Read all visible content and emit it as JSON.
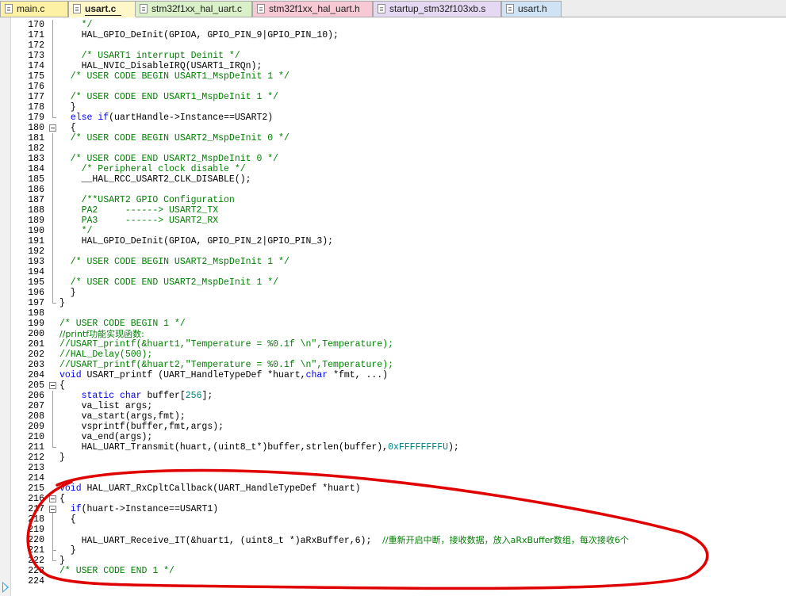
{
  "tabs": [
    {
      "label": "main.c",
      "color": "#fdf1a6",
      "active": false
    },
    {
      "label": "usart.c",
      "color": "#fff7c8",
      "active": true
    },
    {
      "label": "stm32f1xx_hal_uart.c",
      "color": "#d9f0c9",
      "active": false
    },
    {
      "label": "stm32f1xx_hal_uart.h",
      "color": "#f7c9d5",
      "active": false
    },
    {
      "label": "startup_stm32f103xb.s",
      "color": "#e5d8f2",
      "active": false
    },
    {
      "label": "usart.h",
      "color": "#cfe3f5",
      "active": false
    }
  ],
  "editor": {
    "first_line": 170,
    "lines": [
      [
        [
          "    */",
          "c"
        ]
      ],
      [
        [
          "    HAL_GPIO_DeInit(GPIOA, GPIO_PIN_9|GPIO_PIN_10);",
          ""
        ]
      ],
      [
        [
          "",
          ""
        ]
      ],
      [
        [
          "    /* USART1 interrupt Deinit */",
          "c"
        ]
      ],
      [
        [
          "    HAL_NVIC_DisableIRQ(USART1_IRQn);",
          ""
        ]
      ],
      [
        [
          "  /* USER CODE BEGIN USART1_MspDeInit 1 */",
          "c"
        ]
      ],
      [
        [
          "",
          ""
        ]
      ],
      [
        [
          "  /* USER CODE END USART1_MspDeInit 1 */",
          "c"
        ]
      ],
      [
        [
          "  }",
          ""
        ]
      ],
      [
        [
          "  ",
          ""
        ],
        [
          "else",
          "k"
        ],
        [
          " ",
          ""
        ],
        [
          "if",
          "k"
        ],
        [
          "(uartHandle->Instance==USART2)",
          ""
        ]
      ],
      [
        [
          "  {",
          ""
        ]
      ],
      [
        [
          "  /* USER CODE BEGIN USART2_MspDeInit 0 */",
          "c"
        ]
      ],
      [
        [
          "",
          ""
        ]
      ],
      [
        [
          "  /* USER CODE END USART2_MspDeInit 0 */",
          "c"
        ]
      ],
      [
        [
          "    /* Peripheral clock disable */",
          "c"
        ]
      ],
      [
        [
          "    __HAL_RCC_USART2_CLK_DISABLE();",
          ""
        ]
      ],
      [
        [
          "",
          ""
        ]
      ],
      [
        [
          "    /**USART2 GPIO Configuration",
          "c"
        ]
      ],
      [
        [
          "    PA2     ------> USART2_TX",
          "c"
        ]
      ],
      [
        [
          "    PA3     ------> USART2_RX",
          "c"
        ]
      ],
      [
        [
          "    */",
          "c"
        ]
      ],
      [
        [
          "    HAL_GPIO_DeInit(GPIOA, GPIO_PIN_2|GPIO_PIN_3);",
          ""
        ]
      ],
      [
        [
          "",
          ""
        ]
      ],
      [
        [
          "  /* USER CODE BEGIN USART2_MspDeInit 1 */",
          "c"
        ]
      ],
      [
        [
          "",
          ""
        ]
      ],
      [
        [
          "  /* USER CODE END USART2_MspDeInit 1 */",
          "c"
        ]
      ],
      [
        [
          "  }",
          ""
        ]
      ],
      [
        [
          "}",
          ""
        ]
      ],
      [
        [
          "",
          ""
        ]
      ],
      [
        [
          "/* USER CODE BEGIN 1 */",
          "c"
        ]
      ],
      [
        [
          "//printf功能实现函数:",
          "c"
        ]
      ],
      [
        [
          "//USART_printf(&huart1,\"Temperature = %0.1f \\n\",Temperature);",
          "c"
        ]
      ],
      [
        [
          "//HAL_Delay(500);",
          "c"
        ]
      ],
      [
        [
          "//USART_printf(&huart2,\"Temperature = %0.1f \\n\",Temperature);",
          "c"
        ]
      ],
      [
        [
          "void",
          "k"
        ],
        [
          " USART_printf (UART_HandleTypeDef *huart,",
          ""
        ],
        [
          "char",
          "k"
        ],
        [
          " *fmt, ...)",
          ""
        ]
      ],
      [
        [
          "{",
          ""
        ]
      ],
      [
        [
          "    ",
          ""
        ],
        [
          "static",
          "k"
        ],
        [
          " ",
          ""
        ],
        [
          "char",
          "k"
        ],
        [
          " buffer[",
          ""
        ],
        [
          "256",
          "n"
        ],
        [
          "];",
          ""
        ]
      ],
      [
        [
          "    va_list args;",
          ""
        ]
      ],
      [
        [
          "    va_start(args,fmt);",
          ""
        ]
      ],
      [
        [
          "    vsprintf(buffer,fmt,args);",
          ""
        ]
      ],
      [
        [
          "    va_end(args);",
          ""
        ]
      ],
      [
        [
          "    HAL_UART_Transmit(huart,(uint8_t*)buffer,strlen(buffer),",
          ""
        ],
        [
          "0xFFFFFFFFU",
          "n"
        ],
        [
          ");",
          ""
        ]
      ],
      [
        [
          "}",
          ""
        ]
      ],
      [
        [
          "",
          ""
        ]
      ],
      [
        [
          "",
          ""
        ]
      ],
      [
        [
          "void",
          "k"
        ],
        [
          " HAL_UART_RxCpltCallback(UART_HandleTypeDef *huart)",
          ""
        ]
      ],
      [
        [
          "{",
          ""
        ]
      ],
      [
        [
          "  ",
          ""
        ],
        [
          "if",
          "k"
        ],
        [
          "(huart->Instance==USART1)",
          ""
        ]
      ],
      [
        [
          "  {",
          ""
        ]
      ],
      [
        [
          "",
          ""
        ]
      ],
      [
        [
          "    HAL_UART_Receive_IT(&huart1, (uint8_t *)aRxBuffer,6);  ",
          ""
        ],
        [
          "//重新开启中断，接收数据，放入aRxBuffer数组，每次接收6个",
          "c"
        ]
      ],
      [
        [
          "  }",
          ""
        ]
      ],
      [
        [
          "}",
          ""
        ]
      ],
      [
        [
          "/* USER CODE END 1 */",
          "c"
        ]
      ],
      [
        [
          "",
          ""
        ]
      ]
    ],
    "fold_open_lines": [
      180,
      205,
      216,
      217
    ],
    "colors": {
      "keyword": "#0000ff",
      "comment": "#008000",
      "number": "#008080",
      "annotation": "#e00000",
      "marker": "#2aa6e6"
    }
  }
}
